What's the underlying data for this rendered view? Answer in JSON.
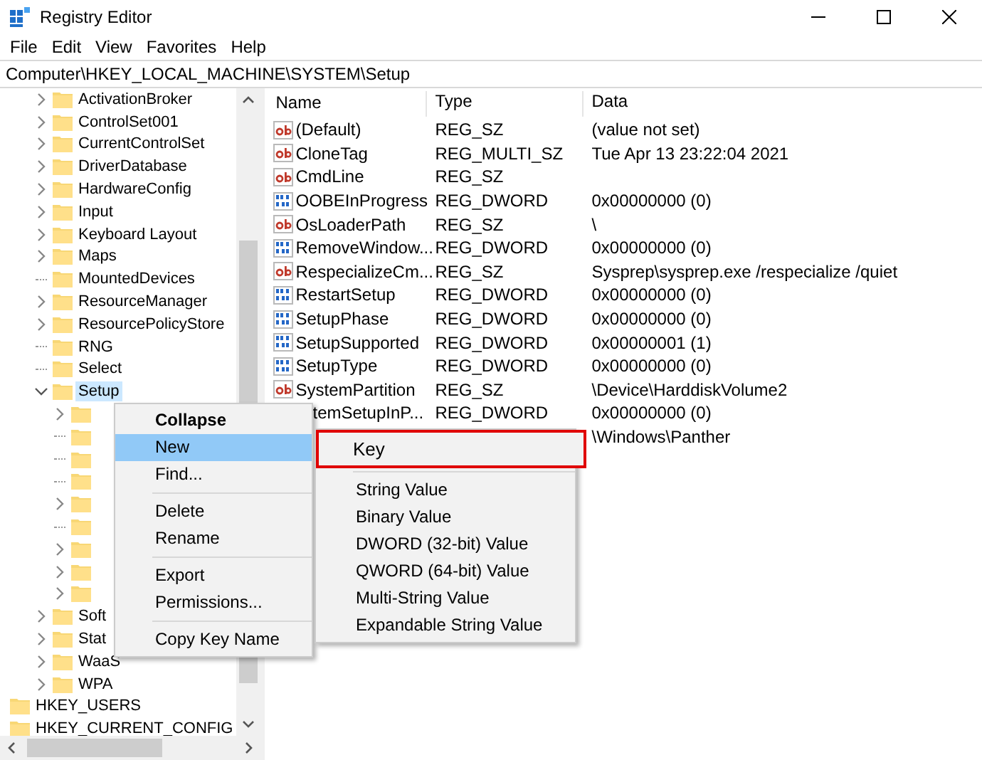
{
  "window": {
    "title": "Registry Editor"
  },
  "menu_bar": [
    "File",
    "Edit",
    "View",
    "Favorites",
    "Help"
  ],
  "address": "Computer\\HKEY_LOCAL_MACHINE\\SYSTEM\\Setup",
  "tree": {
    "items": [
      {
        "label": "ActivationBroker",
        "has_children": true,
        "expanded": false,
        "selected": false
      },
      {
        "label": "ControlSet001",
        "has_children": true,
        "expanded": false,
        "selected": false
      },
      {
        "label": "CurrentControlSet",
        "has_children": true,
        "expanded": false,
        "selected": false
      },
      {
        "label": "DriverDatabase",
        "has_children": true,
        "expanded": false,
        "selected": false
      },
      {
        "label": "HardwareConfig",
        "has_children": true,
        "expanded": false,
        "selected": false
      },
      {
        "label": "Input",
        "has_children": true,
        "expanded": false,
        "selected": false
      },
      {
        "label": "Keyboard Layout",
        "has_children": true,
        "expanded": false,
        "selected": false
      },
      {
        "label": "Maps",
        "has_children": true,
        "expanded": false,
        "selected": false
      },
      {
        "label": "MountedDevices",
        "has_children": false,
        "selected": false
      },
      {
        "label": "ResourceManager",
        "has_children": true,
        "expanded": false,
        "selected": false
      },
      {
        "label": "ResourcePolicyStore",
        "has_children": true,
        "expanded": false,
        "selected": false
      },
      {
        "label": "RNG",
        "has_children": false,
        "selected": false
      },
      {
        "label": "Select",
        "has_children": false,
        "selected": false
      },
      {
        "label": "Setup",
        "has_children": true,
        "expanded": true,
        "selected": true,
        "children": [
          {
            "has_children": true,
            "expanded": false
          },
          {
            "has_children": false
          },
          {
            "has_children": false
          },
          {
            "has_children": false
          },
          {
            "has_children": true,
            "expanded": false
          },
          {
            "has_children": false
          },
          {
            "has_children": true,
            "expanded": false
          },
          {
            "has_children": true,
            "expanded": false
          },
          {
            "has_children": true,
            "expanded": false
          }
        ]
      },
      {
        "label": "Soft",
        "has_children": true,
        "expanded": false,
        "selected": false
      },
      {
        "label": "Stat",
        "has_children": true,
        "expanded": false,
        "selected": false
      },
      {
        "label": "WaaS",
        "has_children": true,
        "expanded": false,
        "selected": false
      },
      {
        "label": "WPA",
        "has_children": true,
        "expanded": false,
        "selected": false
      }
    ],
    "root_items": [
      {
        "label": "HKEY_USERS"
      },
      {
        "label": "HKEY_CURRENT_CONFIG"
      }
    ]
  },
  "table": {
    "columns": [
      "Name",
      "Type",
      "Data"
    ],
    "rows": [
      {
        "kind": "string",
        "name": "(Default)",
        "type": "REG_SZ",
        "data": "(value not set)"
      },
      {
        "kind": "string",
        "name": "CloneTag",
        "type": "REG_MULTI_SZ",
        "data": "Tue Apr 13 23:22:04 2021"
      },
      {
        "kind": "string",
        "name": "CmdLine",
        "type": "REG_SZ"
      },
      {
        "kind": "binary",
        "name": "OOBEInProgress",
        "type": "REG_DWORD",
        "data": "0x00000000 (0)"
      },
      {
        "kind": "string",
        "name": "OsLoaderPath",
        "type": "REG_SZ",
        "data": "\\"
      },
      {
        "kind": "binary",
        "name": "RemoveWindow...",
        "type": "REG_DWORD",
        "data": "0x00000000 (0)"
      },
      {
        "kind": "string",
        "name": "RespecializeCm...",
        "type": "REG_SZ",
        "data": "Sysprep\\sysprep.exe /respecialize /quiet"
      },
      {
        "kind": "binary",
        "name": "RestartSetup",
        "type": "REG_DWORD",
        "data": "0x00000000 (0)"
      },
      {
        "kind": "binary",
        "name": "SetupPhase",
        "type": "REG_DWORD",
        "data": "0x00000000 (0)"
      },
      {
        "kind": "binary",
        "name": "SetupSupported",
        "type": "REG_DWORD",
        "data": "0x00000001 (1)"
      },
      {
        "kind": "binary",
        "name": "SetupType",
        "type": "REG_DWORD",
        "data": "0x00000000 (0)"
      },
      {
        "kind": "string",
        "name": "SystemPartition",
        "type": "REG_SZ",
        "data": "\\Device\\HarddiskVolume2"
      },
      {
        "name": "temSetupInP...",
        "type": "REG_DWORD",
        "data": "0x00000000 (0)"
      },
      {
        "data": "\\Windows\\Panther"
      }
    ]
  },
  "context_menu": {
    "items": [
      {
        "kind": "item",
        "label": "Collapse",
        "bold": true,
        "selected": false
      },
      {
        "kind": "item",
        "label": "New",
        "bold": false,
        "selected": true
      },
      {
        "kind": "item",
        "label": "Find...",
        "bold": false,
        "selected": false
      },
      {
        "kind": "separator"
      },
      {
        "kind": "item",
        "label": "Delete",
        "bold": false,
        "selected": false
      },
      {
        "kind": "item",
        "label": "Rename",
        "bold": false,
        "selected": false
      },
      {
        "kind": "separator"
      },
      {
        "kind": "item",
        "label": "Export",
        "bold": false,
        "selected": false
      },
      {
        "kind": "item",
        "label": "Permissions...",
        "bold": false,
        "selected": false
      },
      {
        "kind": "separator"
      },
      {
        "kind": "item",
        "label": "Copy Key Name",
        "bold": false,
        "selected": false
      }
    ]
  },
  "submenu": {
    "items": [
      {
        "kind": "item",
        "label": "Key",
        "highlighted": true
      },
      {
        "kind": "separator"
      },
      {
        "kind": "item",
        "label": "String Value",
        "highlighted": false
      },
      {
        "kind": "item",
        "label": "Binary Value",
        "highlighted": false
      },
      {
        "kind": "item",
        "label": "DWORD (32-bit) Value",
        "highlighted": false
      },
      {
        "kind": "item",
        "label": "QWORD (64-bit) Value",
        "highlighted": false
      },
      {
        "kind": "item",
        "label": "Multi-String Value",
        "highlighted": false
      },
      {
        "kind": "item",
        "label": "Expandable String Value",
        "highlighted": false
      }
    ]
  }
}
